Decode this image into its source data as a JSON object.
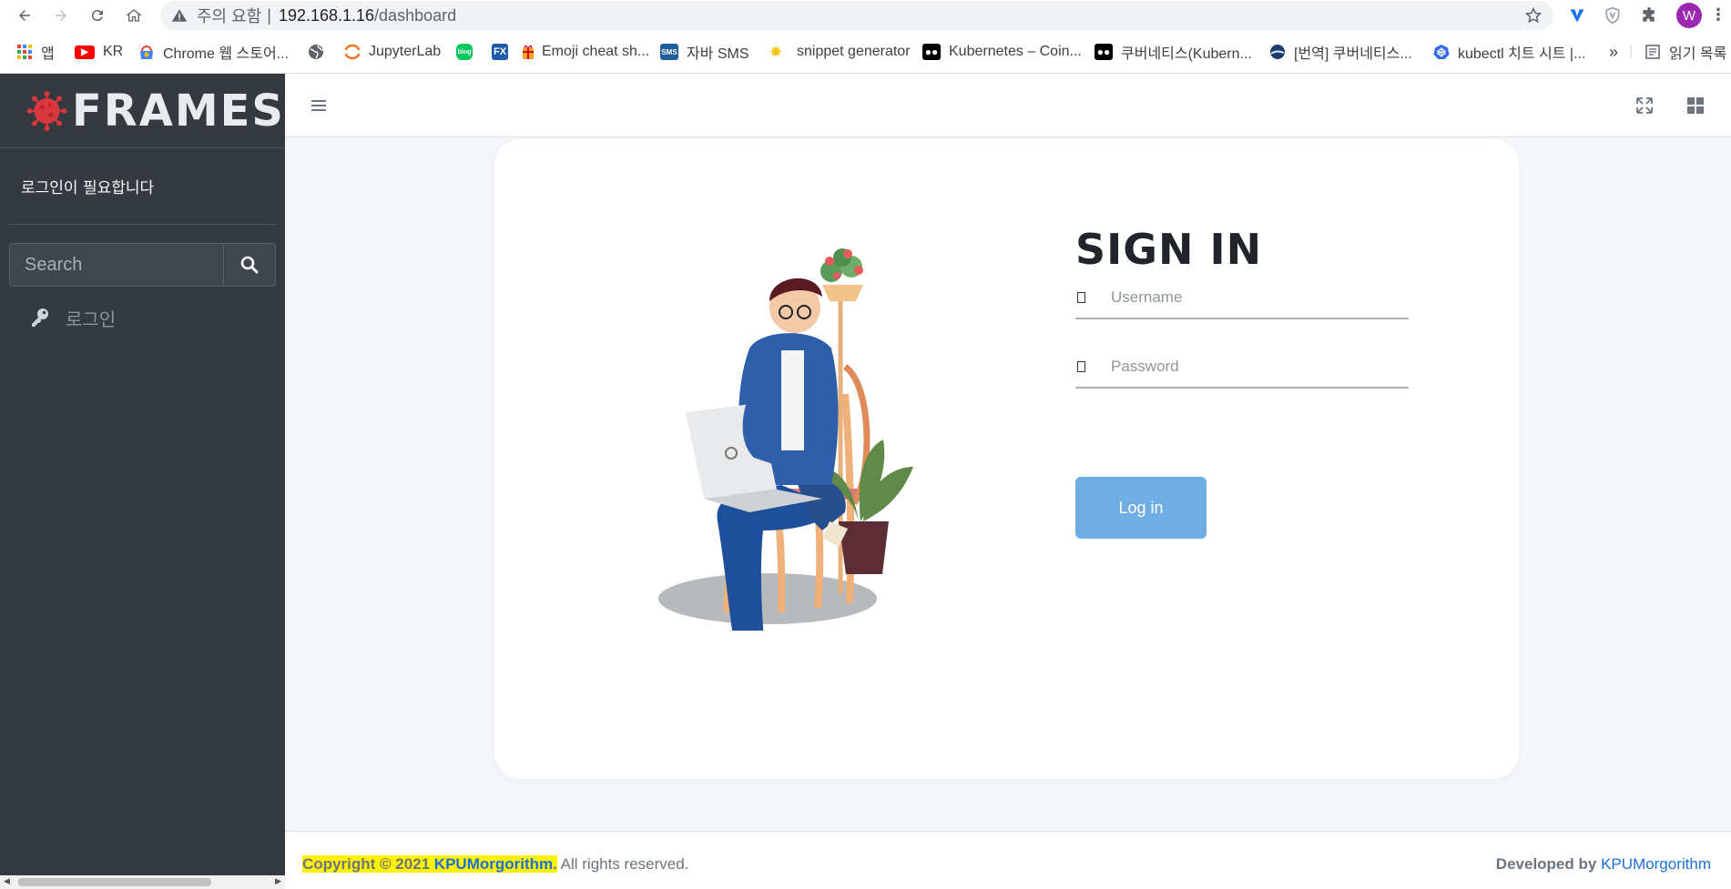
{
  "browser": {
    "security_label": "주의 요함",
    "url_host": "192.168.1.16",
    "url_path": "/dashboard",
    "profile_initial": "W",
    "bookmarks": [
      {
        "label": "앱",
        "icon": "apps-grid-icon"
      },
      {
        "label": "KR",
        "icon": "youtube-icon"
      },
      {
        "label": "Chrome 웹 스토어...",
        "icon": "chrome-webstore-icon"
      },
      {
        "label": "",
        "icon": "globe-icon"
      },
      {
        "label": "JupyterLab",
        "icon": "jupyter-icon"
      },
      {
        "label": "",
        "icon": "blog-icon"
      },
      {
        "label": "",
        "icon": "fx-icon"
      },
      {
        "label": "Emoji cheat sh...",
        "icon": "emoji-icon"
      },
      {
        "label": "자바 SMS",
        "icon": "sms-icon"
      },
      {
        "label": "snippet generator",
        "icon": "snippet-icon"
      },
      {
        "label": "Kubernetes – Coin...",
        "icon": "medium-icon"
      },
      {
        "label": "쿠버네티스(Kubern...",
        "icon": "medium-icon"
      },
      {
        "label": "[번역] 쿠버네티스...",
        "icon": "blog-globe-icon"
      },
      {
        "label": "kubectl 치트 시트 |...",
        "icon": "kubernetes-icon"
      }
    ],
    "more_label": "»",
    "reading_list_label": "읽기 목록"
  },
  "sidebar": {
    "brand": "FRAMES",
    "user_status": "로그인이 필요합니다",
    "search_placeholder": "Search",
    "nav_login": "로그인"
  },
  "login": {
    "title": "SIGN IN",
    "username_placeholder": "Username",
    "password_placeholder": "Password",
    "button": "Log in"
  },
  "footer": {
    "copyright_prefix": "Copyright © 2021 ",
    "copyright_brand": "KPUMorgorithm",
    "copyright_dot": ".",
    "rights": " All rights reserved.",
    "developed_by": "Developed by",
    "developer": "KPUMorgorithm"
  },
  "colors": {
    "sidebar_bg": "#343a40",
    "button_blue": "#6faee5",
    "highlight_yellow": "#fff300",
    "link_blue": "#1c6fd6"
  }
}
